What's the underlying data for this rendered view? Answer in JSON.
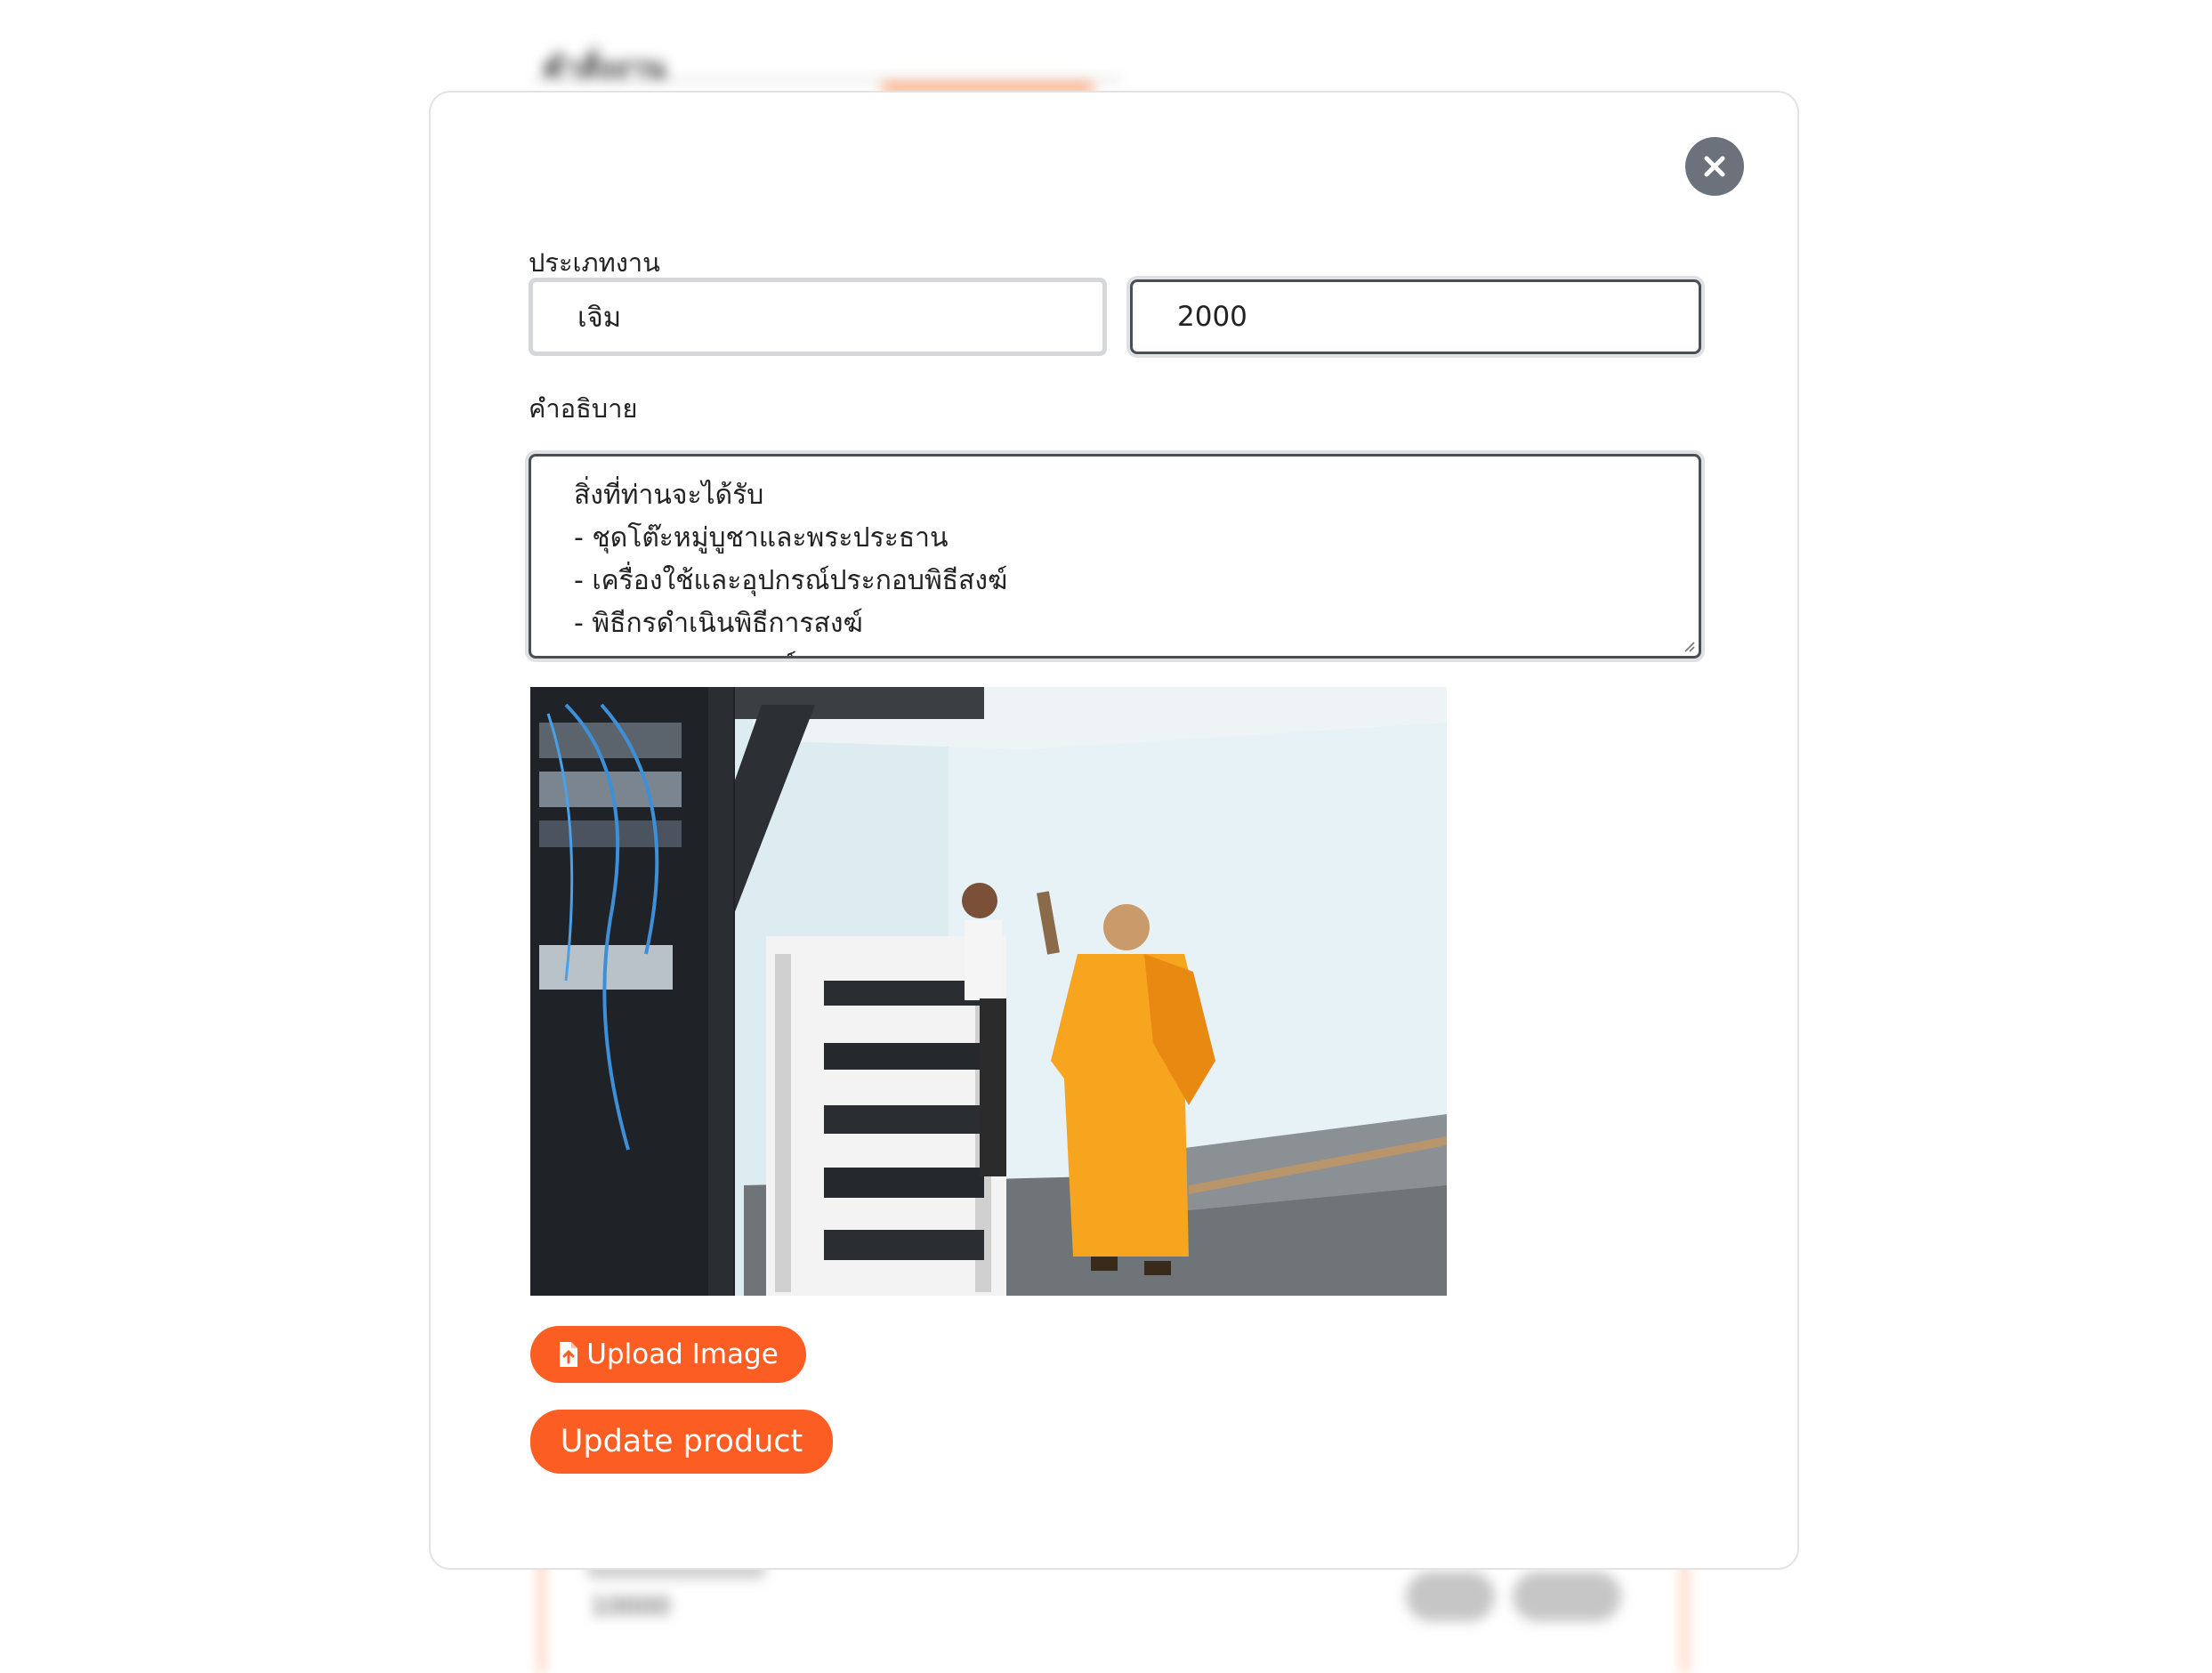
{
  "background": {
    "title": "คำสั่งงาน",
    "card_line": "10000"
  },
  "modal": {
    "category_label": "ประเภทงาน",
    "category_value": "เจิม",
    "price_value": "2000",
    "description_label": "คำอธิบาย",
    "description_lines": [
      "สิ่งที่ท่านจะได้รับ",
      "- ชุดโต๊ะหมู่บูชาและพระประธาน",
      "- เครื่องใช้และอุปกรณ์ประกอบพิธีสงฆ์",
      "- พิธีกรดำเนินพิธีการสงฆ์",
      "- ของถวายพระสงฆ์"
    ],
    "upload_label": "Upload Image",
    "submit_label": "Update product"
  },
  "colors": {
    "accent": "#fb5d22",
    "close_button": "#6c727b"
  },
  "icons": {
    "close": "close-icon",
    "upload": "file-upload-icon"
  }
}
